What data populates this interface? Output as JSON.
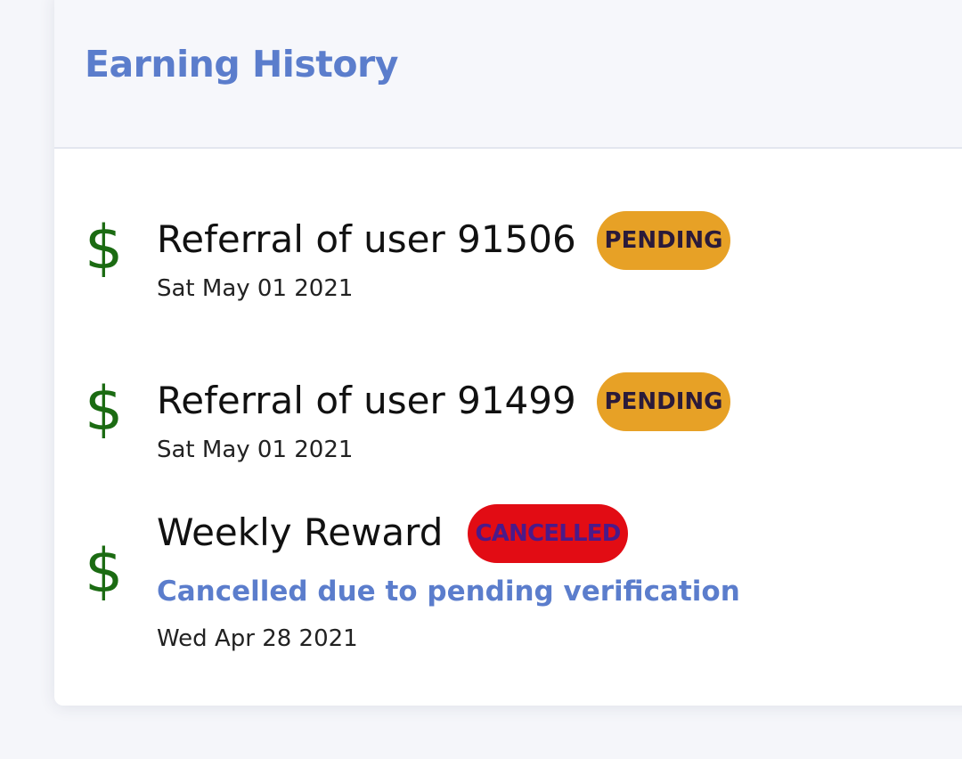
{
  "header": {
    "title": "Earning History"
  },
  "colors": {
    "title": "#5b7dcc",
    "dollar": "#1b6b12",
    "pending_bg": "#e7a126",
    "pending_text": "#2a1a3a",
    "cancelled_bg": "#e20c14",
    "cancelled_text": "#4a1a8a",
    "note": "#5b7dcc"
  },
  "entries": [
    {
      "icon": "dollar-icon",
      "icon_glyph": "$",
      "title": "Referral of user 91506",
      "status": "PENDING",
      "status_type": "pending",
      "note": "",
      "date": "Sat May 01 2021"
    },
    {
      "icon": "dollar-icon",
      "icon_glyph": "$",
      "title": "Referral of user 91499",
      "status": "PENDING",
      "status_type": "pending",
      "note": "",
      "date": "Sat May 01 2021"
    },
    {
      "icon": "dollar-icon",
      "icon_glyph": "$",
      "title": "Weekly Reward",
      "status": "CANCELLED",
      "status_type": "cancelled",
      "note": "Cancelled due to pending verification",
      "date": "Wed Apr 28 2021"
    }
  ]
}
